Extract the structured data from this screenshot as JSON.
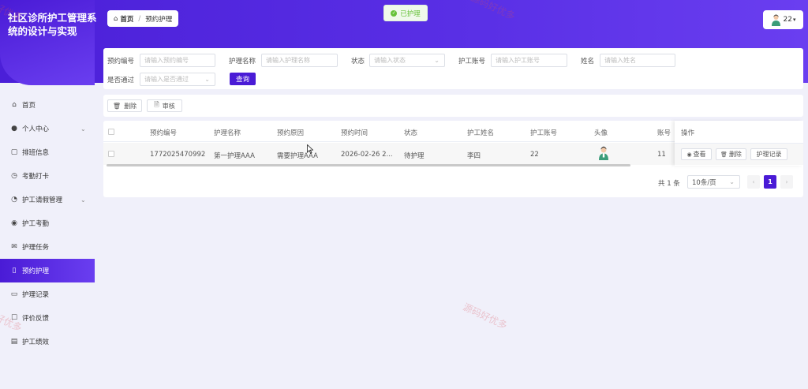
{
  "app": {
    "title": "社区诊所护工管理系统的设计与实现"
  },
  "breadcrumb": {
    "home": "首页",
    "separator": "/",
    "current": "预约护理"
  },
  "toast": {
    "text": "已护理"
  },
  "user": {
    "name": "22"
  },
  "sidebar": {
    "items": [
      {
        "label": "首页",
        "icon": "home-icon",
        "chevron": ""
      },
      {
        "label": "个人中心",
        "icon": "user-icon",
        "chevron": "⌄"
      },
      {
        "label": "排班信息",
        "icon": "schedule-icon",
        "chevron": ""
      },
      {
        "label": "考勤打卡",
        "icon": "clock-in-icon",
        "chevron": ""
      },
      {
        "label": "护工请假管理",
        "icon": "leave-icon",
        "chevron": "⌄"
      },
      {
        "label": "护工考勤",
        "icon": "attendance-icon",
        "chevron": ""
      },
      {
        "label": "护理任务",
        "icon": "task-icon",
        "chevron": ""
      },
      {
        "label": "预约护理",
        "icon": "appointment-icon",
        "chevron": ""
      },
      {
        "label": "护理记录",
        "icon": "record-icon",
        "chevron": ""
      },
      {
        "label": "评价反馈",
        "icon": "feedback-icon",
        "chevron": ""
      },
      {
        "label": "护工绩效",
        "icon": "performance-icon",
        "chevron": ""
      }
    ],
    "active_index": 7
  },
  "search": {
    "booking_no": {
      "label": "预约编号",
      "placeholder": "请输入预约编号"
    },
    "care_name": {
      "label": "护理名称",
      "placeholder": "请输入护理名称"
    },
    "status": {
      "label": "状态",
      "placeholder": "请输入状态"
    },
    "worker_account": {
      "label": "护工账号",
      "placeholder": "请输入护工账号"
    },
    "name": {
      "label": "姓名",
      "placeholder": "请输入姓名"
    },
    "approved": {
      "label": "是否通过",
      "placeholder": "请输入是否通过"
    },
    "query_label": "查询"
  },
  "actions": {
    "delete_label": "删除",
    "review_label": "审核"
  },
  "table": {
    "columns": [
      "预约编号",
      "护理名称",
      "预约原因",
      "预约时间",
      "状态",
      "护工姓名",
      "护工账号",
      "头像",
      "账号",
      "操作"
    ],
    "rows": [
      {
        "booking_no": "1772025470992",
        "care_name": "第一护理AAA",
        "reason": "需要护理AAA",
        "time": "2026-02-26 2...",
        "status": "待护理",
        "worker_name": "李四",
        "worker_account": "22",
        "account": "11"
      }
    ],
    "row_actions": {
      "view": "查看",
      "delete": "删除",
      "record": "护理记录"
    }
  },
  "pagination": {
    "total_text": "共 1 条",
    "page_size": "10条/页",
    "current_page": "1",
    "prev": "‹",
    "next": "›"
  },
  "watermark": {
    "text": "源码好优多"
  },
  "colors": {
    "primary": "#4a1bd6",
    "success": "#67c23a"
  }
}
